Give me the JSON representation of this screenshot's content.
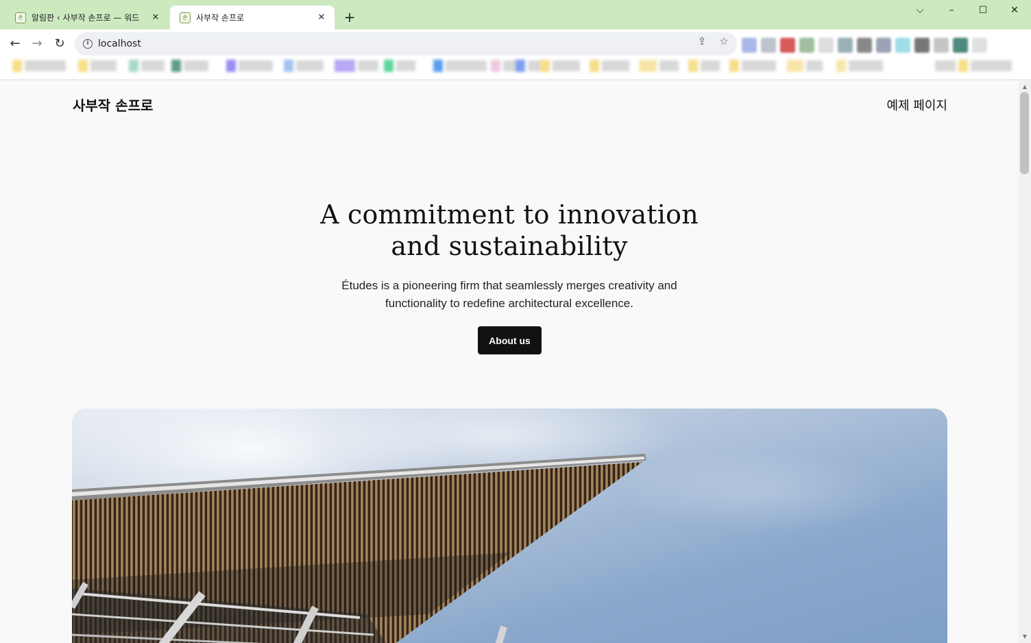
{
  "browser": {
    "tabs": [
      {
        "title": "알림판 ‹ 사부작 손프로 — 워드",
        "active": false,
        "favicon": "site-favicon"
      },
      {
        "title": "사부작 손프로",
        "active": true,
        "favicon": "site-favicon"
      }
    ],
    "address": {
      "url": "localhost"
    },
    "colors": {
      "tabstrip": "#cce9c0",
      "toolbar": "#ffffff"
    }
  },
  "page": {
    "site_title": "사부작 손프로",
    "nav_link": "예제 페이지",
    "hero": {
      "heading_line1": "A commitment to innovation",
      "heading_line2": "and sustainability",
      "text_line1": "Études is a pioneering firm that seamlessly merges creativity and",
      "text_line2": "functionality to redefine architectural excellence.",
      "button_label": "About us"
    },
    "image": {
      "subject": "building roof with wooden slats against a blue sky"
    },
    "colors": {
      "background": "#f9f9f9",
      "button": "#111111",
      "button_text": "#ffffff"
    }
  }
}
